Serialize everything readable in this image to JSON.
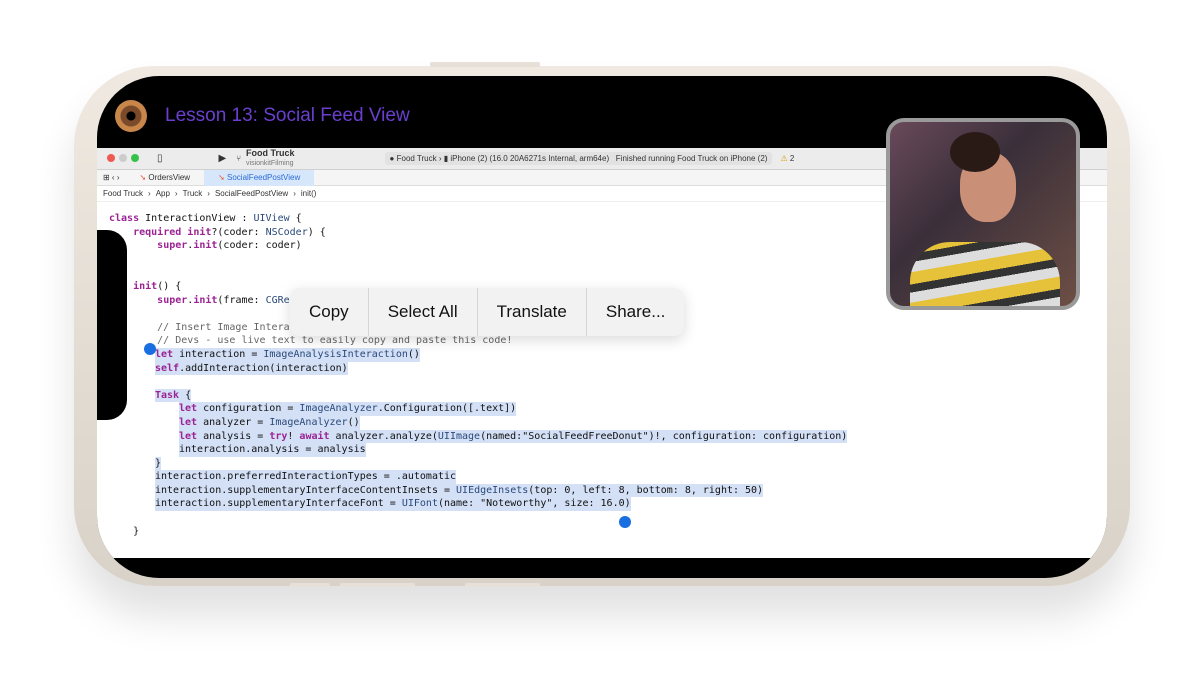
{
  "lesson_title": "Lesson 13: Social Feed View",
  "toolbar": {
    "project": "Food Truck",
    "branch": "visionkitFilming",
    "scheme": "Food Truck",
    "device": "iPhone (2) (16.0 20A6271s Internal, arm64e)",
    "status": "Finished running Food Truck on iPhone (2)",
    "warnings": "2"
  },
  "tabs": [
    {
      "label": "OrdersView"
    },
    {
      "label": "SocialFeedPostView"
    }
  ],
  "breadcrumb": [
    "Food Truck",
    "App",
    "Truck",
    "SocialFeedPostView",
    "init()"
  ],
  "code": [
    "class InteractionView : UIView {",
    "    required init?(coder: NSCoder) {",
    "        super.init(coder: coder)",
    "",
    "",
    "    init() {",
    "        super.init(frame: CGRect.zero)",
    "",
    "        // Insert Image Interaction",
    "        // Devs - use live text to easily copy and paste this code!",
    "        let interaction = ImageAnalysisInteraction()",
    "        self.addInteraction(interaction)",
    "",
    "        Task {",
    "            let configuration = ImageAnalyzer.Configuration([.text])",
    "            let analyzer = ImageAnalyzer()",
    "            let analysis = try! await analyzer.analyze(UIImage(named:\"SocialFeedFreeDonut\")!, configuration: configuration)",
    "            interaction.analysis = analysis",
    "        }",
    "        interaction.preferredInteractionTypes = .automatic",
    "        interaction.supplementaryInterfaceContentInsets = UIEdgeInsets(top: 0, left: 8, bottom: 8, right: 50)",
    "        interaction.supplementaryInterfaceFont = UIFont(name: \"Noteworthy\", size: 16.0)",
    "",
    "    }"
  ],
  "context_menu": [
    "Copy",
    "Select All",
    "Translate",
    "Share..."
  ],
  "colors": {
    "accent": "#1a6fe0",
    "selection": "#d3e0f6",
    "title": "#6a3fd0"
  }
}
